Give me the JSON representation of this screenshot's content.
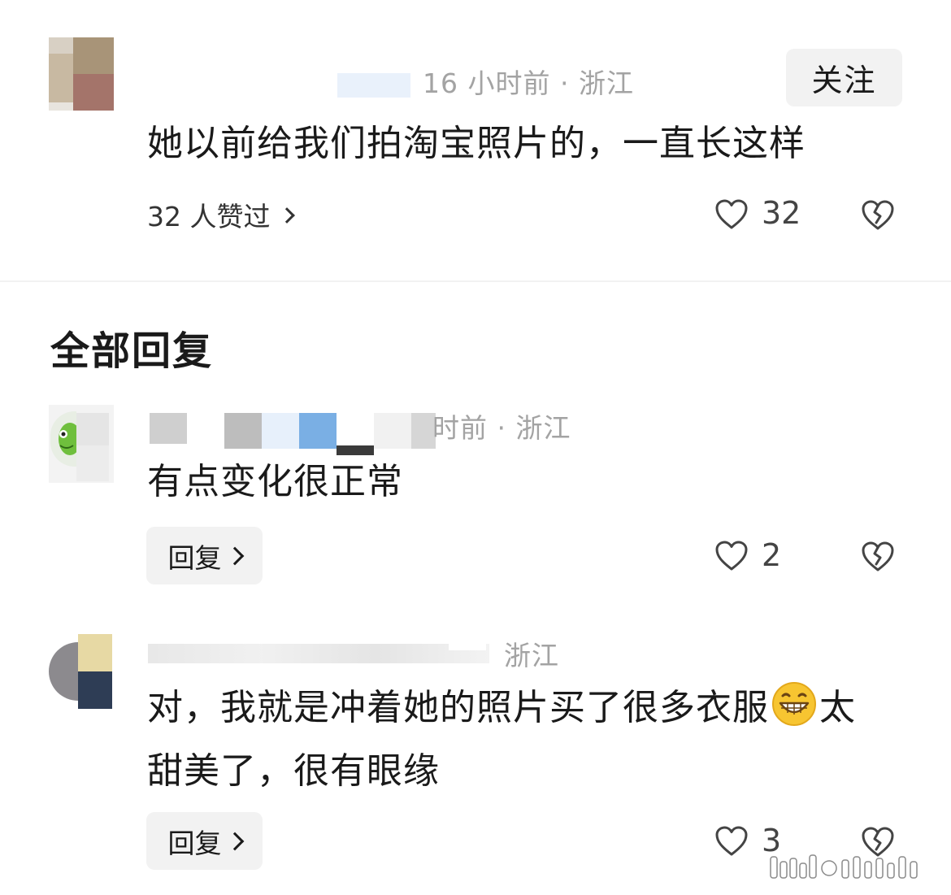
{
  "main_comment": {
    "meta": "16 小时前 · 浙江",
    "follow_label": "关注",
    "text": "她以前给我们拍淘宝照片的，一直长这样",
    "likers_label": "32 人赞过",
    "like_count": "32"
  },
  "replies_section": {
    "title": "全部回复",
    "replies": [
      {
        "meta": "时前 · 浙江",
        "text": "有点变化很正常",
        "reply_label": "回复",
        "like_count": "2"
      },
      {
        "meta": "浙江",
        "text_line1_a": "对，我就是冲着她的照片买了很多衣服",
        "text_line1_b": "太",
        "text_line2": "甜美了，很有眼缘",
        "emoji": "grinning-face-icon",
        "reply_label": "回复",
        "like_count": "3"
      }
    ]
  },
  "colors": {
    "meta_text": "#a3a3a3",
    "button_bg": "#f2f2f2",
    "icon_stroke": "#444444"
  }
}
